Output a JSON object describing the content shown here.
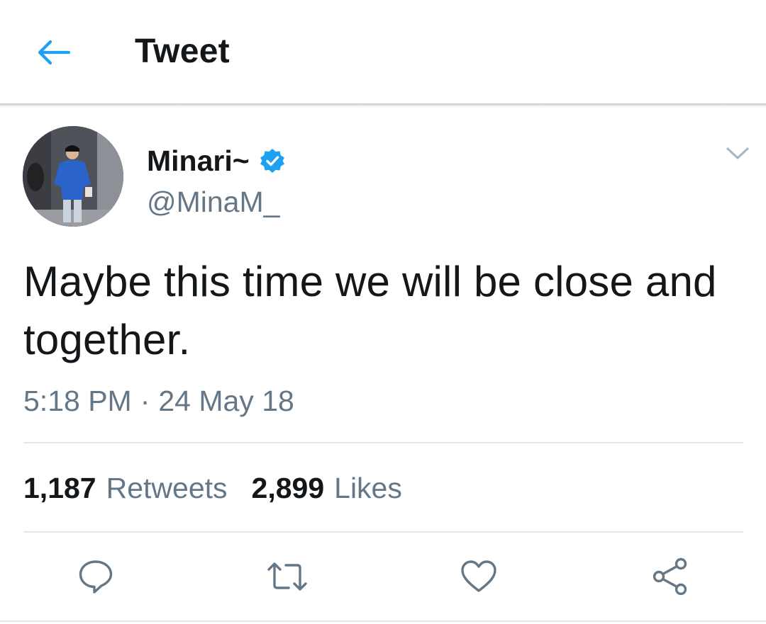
{
  "header": {
    "title": "Tweet",
    "back_icon": "arrow-left-icon"
  },
  "tweet": {
    "display_name": "Minari~",
    "handle": "@MinaM_",
    "verified": true,
    "text": "Maybe this time we will be close and together.",
    "time": "5:18 PM",
    "separator": "·",
    "date": "24 May 18"
  },
  "stats": {
    "retweets_count": "1,187",
    "retweets_label": "Retweets",
    "likes_count": "2,899",
    "likes_label": "Likes"
  },
  "actions": [
    {
      "icon": "reply-icon"
    },
    {
      "icon": "retweet-icon"
    },
    {
      "icon": "like-icon"
    },
    {
      "icon": "share-icon"
    }
  ],
  "colors": {
    "accent": "#1da1f2",
    "text_primary": "#14171a",
    "text_secondary": "#657786",
    "divider": "#e1e8ed"
  }
}
